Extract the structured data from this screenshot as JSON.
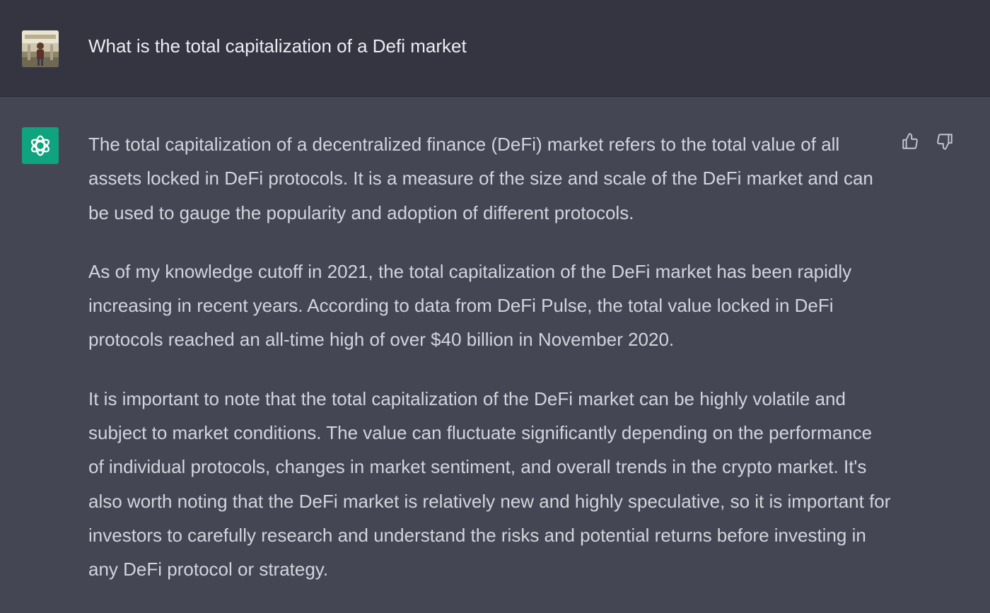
{
  "user": {
    "message": "What is the total capitalization of a Defi market"
  },
  "assistant": {
    "paragraphs": [
      "The total capitalization of a decentralized finance (DeFi) market refers to the total value of all assets locked in DeFi protocols. It is a measure of the size and scale of the DeFi market and can be used to gauge the popularity and adoption of different protocols.",
      "As of my knowledge cutoff in 2021, the total capitalization of the DeFi market has been rapidly increasing in recent years. According to data from DeFi Pulse, the total value locked in DeFi protocols reached an all-time high of over $40 billion in November 2020.",
      "It is important to note that the total capitalization of the DeFi market can be highly volatile and subject to market conditions. The value can fluctuate significantly depending on the performance of individual protocols, changes in market sentiment, and overall trends in the crypto market. It's also worth noting that the DeFi market is relatively new and highly speculative, so it is important for investors to carefully research and understand the risks and potential returns before investing in any DeFi protocol or strategy."
    ]
  },
  "icons": {
    "user_avatar": "user-avatar-photo",
    "assistant_avatar": "openai-logo-icon",
    "feedback_up": "thumbs-up-icon",
    "feedback_down": "thumbs-down-icon"
  },
  "colors": {
    "user_row_bg": "#343541",
    "assistant_row_bg": "#444654",
    "assistant_avatar_bg": "#10a37f",
    "text": "#d1d5db"
  }
}
